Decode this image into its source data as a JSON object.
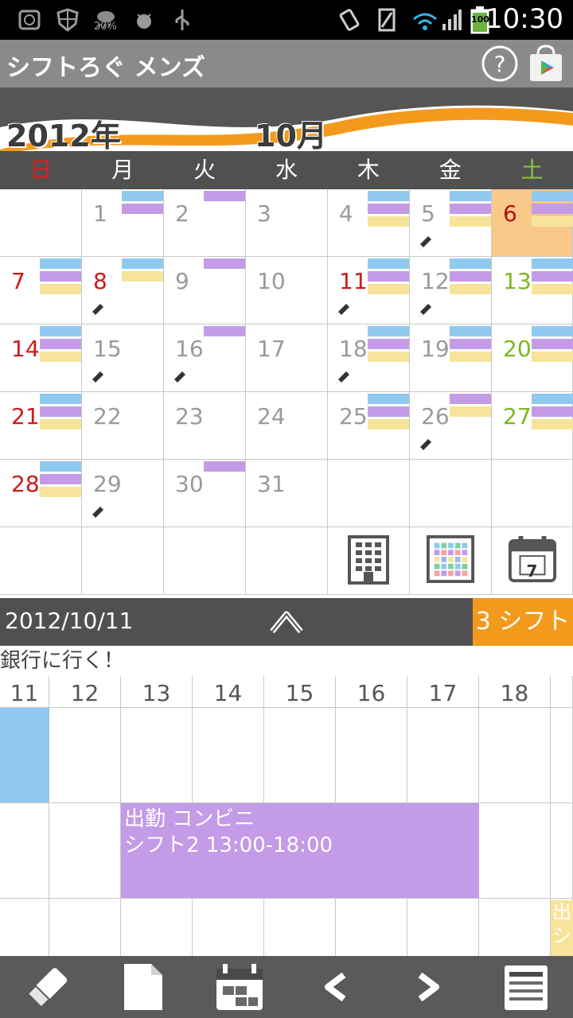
{
  "status_bar": {
    "time": "10:30",
    "weather_percent": "20%",
    "battery": "100"
  },
  "app": {
    "title": "シフトろぐ メンズ"
  },
  "banner": {
    "year": "2012年",
    "month": "10月"
  },
  "weekdays": [
    "日",
    "月",
    "火",
    "水",
    "木",
    "金",
    "土"
  ],
  "calendar": {
    "weeks": [
      [
        {
          "d": ""
        },
        {
          "d": "1",
          "bars": [
            "b",
            "p"
          ]
        },
        {
          "d": "2",
          "bars": [
            "p"
          ]
        },
        {
          "d": "3",
          "bars": []
        },
        {
          "d": "4",
          "bars": [
            "b",
            "p",
            "y"
          ]
        },
        {
          "d": "5",
          "bars": [
            "b",
            "p",
            "y"
          ],
          "memo": true
        },
        {
          "d": "6",
          "bars": [
            "b",
            "p",
            "y"
          ],
          "today": true
        }
      ],
      [
        {
          "d": "7",
          "bars": [
            "b",
            "p",
            "y"
          ]
        },
        {
          "d": "8",
          "bars": [
            "b",
            "y"
          ],
          "memo": true,
          "holiday": true
        },
        {
          "d": "9",
          "bars": [
            "p"
          ]
        },
        {
          "d": "10",
          "bars": []
        },
        {
          "d": "11",
          "bars": [
            "b",
            "p",
            "y"
          ],
          "memo": true,
          "holiday": true
        },
        {
          "d": "12",
          "bars": [
            "b",
            "p",
            "y"
          ],
          "memo": true
        },
        {
          "d": "13",
          "bars": [
            "b",
            "p",
            "y"
          ]
        }
      ],
      [
        {
          "d": "14",
          "bars": [
            "b",
            "p",
            "y"
          ]
        },
        {
          "d": "15",
          "bars": [],
          "memo": true
        },
        {
          "d": "16",
          "bars": [
            "p"
          ],
          "memo": true
        },
        {
          "d": "17",
          "bars": []
        },
        {
          "d": "18",
          "bars": [
            "b",
            "p",
            "y"
          ],
          "memo": true
        },
        {
          "d": "19",
          "bars": [
            "b",
            "p",
            "y"
          ]
        },
        {
          "d": "20",
          "bars": [
            "b",
            "p",
            "y"
          ]
        }
      ],
      [
        {
          "d": "21",
          "bars": [
            "b",
            "p",
            "y"
          ]
        },
        {
          "d": "22",
          "bars": []
        },
        {
          "d": "23",
          "bars": []
        },
        {
          "d": "24",
          "bars": []
        },
        {
          "d": "25",
          "bars": [
            "b",
            "p",
            "y"
          ]
        },
        {
          "d": "26",
          "bars": [
            "p",
            "y"
          ],
          "memo": true
        },
        {
          "d": "27",
          "bars": [
            "b",
            "p",
            "y"
          ]
        }
      ],
      [
        {
          "d": "28",
          "bars": [
            "b",
            "p",
            "y"
          ]
        },
        {
          "d": "29",
          "bars": [],
          "memo": true
        },
        {
          "d": "30",
          "bars": [
            "p"
          ]
        },
        {
          "d": "31",
          "bars": []
        },
        {
          "d": ""
        },
        {
          "d": ""
        },
        {
          "d": ""
        }
      ]
    ],
    "shortcut_icons": [
      "building-icon",
      "color-grid-icon",
      "calendar-7-icon"
    ],
    "shortcut_day": "7"
  },
  "detail": {
    "date": "2012/10/11",
    "shift_count": "3 シフト",
    "memo": "銀行に行く！",
    "hours": [
      "11",
      "12",
      "13",
      "14",
      "15",
      "16",
      "17",
      "18"
    ],
    "shift_event": {
      "line1": "出勤 コンビニ",
      "line2": "シフト2 13:00-18:00"
    },
    "partial_event": {
      "line1": "出",
      "line2": "シ"
    }
  },
  "toolbar_icons": [
    "eraser-icon",
    "document-icon",
    "calendar-grid-icon",
    "prev-icon",
    "next-icon",
    "list-icon"
  ],
  "colors": {
    "orange": "#f39a1d",
    "blue": "#8fc9ef",
    "purple": "#c39be6",
    "yellow": "#f7e49a",
    "today_bg": "#f9c98a"
  }
}
